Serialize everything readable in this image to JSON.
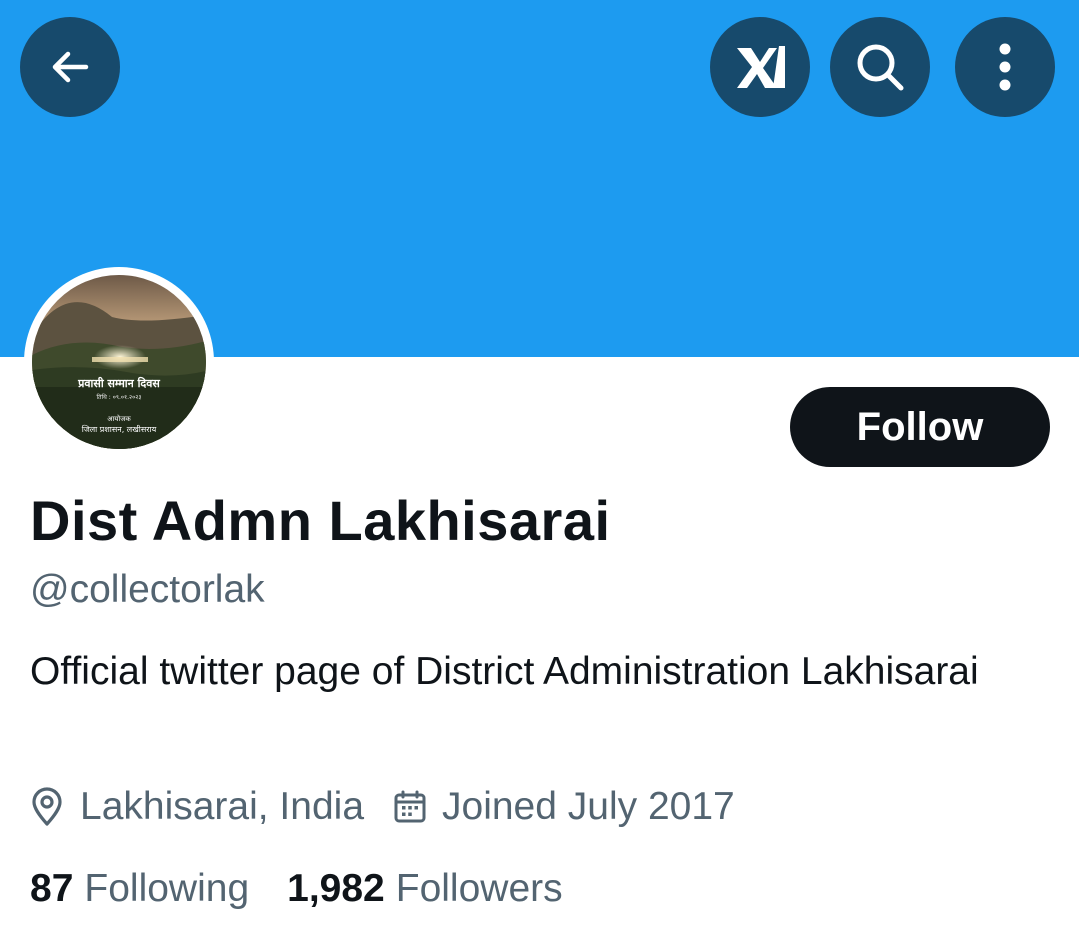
{
  "header": {
    "banner_color": "#1d9bf0",
    "back_icon": "arrow-left-icon",
    "grok_icon": "grok-icon",
    "search_icon": "search-icon",
    "more_icon": "more-vertical-icon"
  },
  "profile": {
    "avatar": {
      "icon": "avatar-image",
      "caption_line1": "प्रवासी सम्मान दिवस",
      "caption_line2": "तिथि : ०९.०१.२०२३",
      "caption_line3": "आयोजक",
      "caption_line4": "जिला प्रशासन, लखीसराय"
    },
    "follow_label": "Follow",
    "display_name": "Dist Admn Lakhisarai",
    "handle": "@collectorlak",
    "bio": "Official twitter page of District Administration Lakhisarai",
    "location": "Lakhisarai, India",
    "joined": "Joined July 2017",
    "following_count": "87",
    "following_label": "Following",
    "followers_count": "1,982",
    "followers_label": "Followers"
  }
}
